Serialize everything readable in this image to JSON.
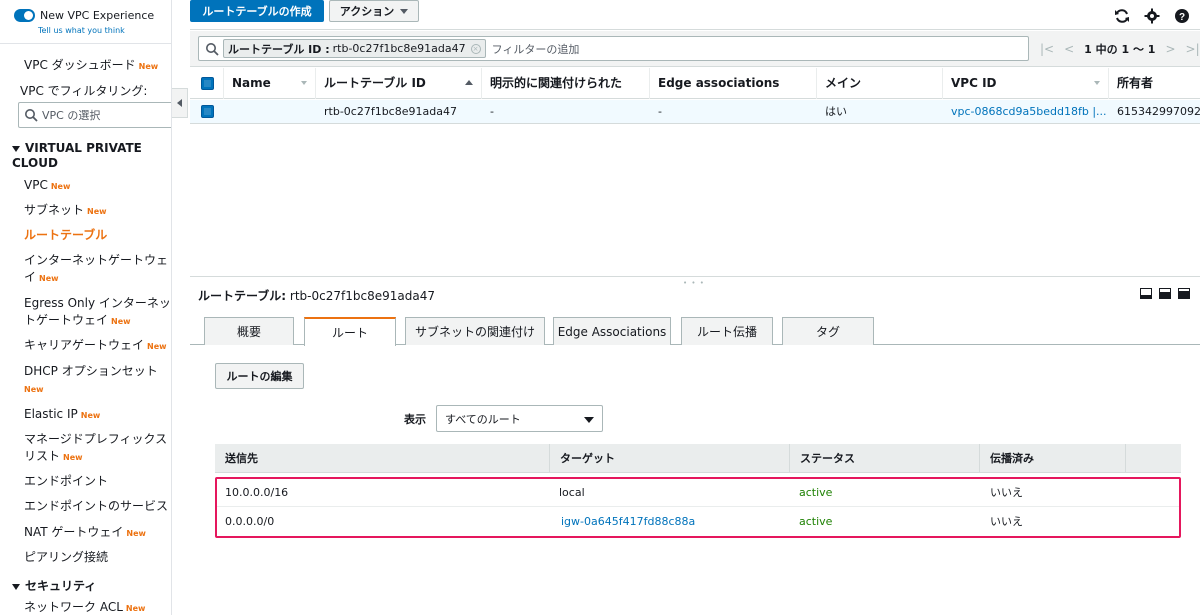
{
  "sidebar": {
    "toggle_label": "New VPC Experience",
    "tell_us": "Tell us what you think",
    "new_badge": "New",
    "dashboard": "VPC ダッシュボード",
    "filter_label": "VPC でフィルタリング:",
    "vpc_select_placeholder": "VPC の選択",
    "section_vpc": "VIRTUAL PRIVATE CLOUD",
    "section_security": "セキュリティ",
    "items": [
      {
        "label": "VPC",
        "new": true
      },
      {
        "label": "サブネット",
        "new": true
      },
      {
        "label": "ルートテーブル",
        "new": false,
        "active": true
      },
      {
        "label": "インターネットゲートウェイ",
        "new": true
      },
      {
        "label": "Egress Only インターネットゲートウェイ",
        "new": true
      },
      {
        "label": "キャリアゲートウェイ",
        "new": true
      },
      {
        "label": "DHCP オプションセット",
        "new": true
      },
      {
        "label": "Elastic IP",
        "new": true
      },
      {
        "label": "マネージドプレフィックスリスト",
        "new": true
      },
      {
        "label": "エンドポイント",
        "new": false
      },
      {
        "label": "エンドポイントのサービス",
        "new": false
      },
      {
        "label": "NAT ゲートウェイ",
        "new": true
      },
      {
        "label": "ピアリング接続",
        "new": false
      }
    ],
    "security_items": [
      {
        "label": "ネットワーク ACL",
        "new": true
      }
    ]
  },
  "toolbar": {
    "create_label": "ルートテーブルの作成",
    "action_label": "アクション"
  },
  "filter": {
    "token_key": "ルートテーブル ID :",
    "token_value": "rtb-0c27f1bc8e91ada47",
    "placeholder": "フィルターの追加",
    "page_text": "1 中の 1 〜 1"
  },
  "grid": {
    "headers": [
      "Name",
      "ルートテーブル ID",
      "明示的に関連付けられた",
      "Edge associations",
      "メイン",
      "VPC ID",
      "所有者"
    ],
    "row": {
      "name": "",
      "route_table_id": "rtb-0c27f1bc8e91ada47",
      "explicit": "-",
      "edge": "-",
      "main": "はい",
      "vpc_id": "vpc-0868cd9a5bedd18fb |...",
      "owner": "615342997092"
    }
  },
  "detail": {
    "title_label": "ルートテーブル:",
    "title_value": "rtb-0c27f1bc8e91ada47",
    "tabs": [
      "概要",
      "ルート",
      "サブネットの関連付け",
      "Edge Associations",
      "ルート伝播",
      "タグ"
    ],
    "edit_button": "ルートの編集",
    "view_label": "表示",
    "view_value": "すべてのルート",
    "routes_headers": [
      "送信先",
      "ターゲット",
      "ステータス",
      "伝播済み"
    ],
    "routes": [
      {
        "destination": "10.0.0.0/16",
        "target": "local",
        "status": "active",
        "propagated": "いいえ"
      },
      {
        "destination": "0.0.0.0/0",
        "target": "igw-0a645f417fd88c88a",
        "status": "active",
        "propagated": "いいえ"
      }
    ]
  },
  "colors": {
    "primary": "#0073bb",
    "accent": "#ec7211",
    "active_status": "#1d8102",
    "highlight_border": "#e5175d"
  },
  "icons": [
    "refresh-icon",
    "gear-icon",
    "help-icon",
    "search-icon",
    "first-page-icon",
    "prev-page-icon",
    "next-page-icon",
    "last-page-icon"
  ]
}
